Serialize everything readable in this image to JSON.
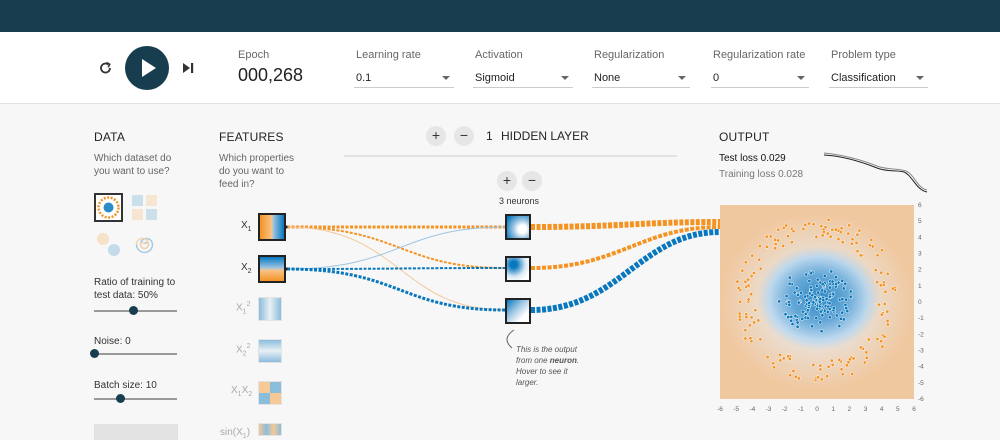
{
  "controls": {
    "epoch_label": "Epoch",
    "epoch_value": "000,268",
    "learning_rate": {
      "label": "Learning rate",
      "value": "0.1"
    },
    "activation": {
      "label": "Activation",
      "value": "Sigmoid"
    },
    "regularization": {
      "label": "Regularization",
      "value": "None"
    },
    "regularization_rate": {
      "label": "Regularization rate",
      "value": "0"
    },
    "problem_type": {
      "label": "Problem type",
      "value": "Classification"
    }
  },
  "data_panel": {
    "heading": "DATA",
    "question": [
      "Which dataset do",
      "you want to use?"
    ],
    "ratio_label": [
      "Ratio of training to",
      "test data:  50%"
    ],
    "ratio_fraction": 0.5,
    "noise_label": "Noise:  0",
    "noise_fraction": 0.0,
    "batch_label": "Batch size:  10",
    "batch_fraction": 0.33
  },
  "features_panel": {
    "heading": "FEATURES",
    "question": [
      "Which properties",
      "do you want to",
      "feed in?"
    ],
    "features": [
      {
        "base": "X",
        "sub": "1",
        "sup": ""
      },
      {
        "base": "X",
        "sub": "2",
        "sup": ""
      },
      {
        "base": "X",
        "sub": "1",
        "sup": "2"
      },
      {
        "base": "X",
        "sub": "2",
        "sup": "2"
      },
      {
        "base": "X",
        "sub": "1",
        "base2": "X",
        "sub2": "2"
      },
      {
        "base": "sin(X",
        "sub": "1",
        "tail": ")"
      }
    ]
  },
  "network": {
    "plus": "+",
    "minus": "−",
    "layers_count": "1",
    "layers_label": "HIDDEN LAYER",
    "neurons_label": "3 neurons",
    "tooltip": [
      "This is the output",
      "from one ",
      "neuron",
      ". ",
      "Hover to see it",
      "larger."
    ]
  },
  "output_panel": {
    "heading": "OUTPUT",
    "test_loss": "Test loss 0.029",
    "training_loss": "Training loss 0.028",
    "x_ticks": [
      "-6",
      "-5",
      "-4",
      "-3",
      "-2",
      "-1",
      "0",
      "1",
      "2",
      "3",
      "4",
      "5",
      "6"
    ],
    "y_ticks": [
      "6",
      "5",
      "4",
      "3",
      "2",
      "1",
      "0",
      "-1",
      "-2",
      "-3",
      "-4",
      "-5",
      "-6"
    ]
  },
  "colors": {
    "orange": "#f59322",
    "blue": "#0877bd",
    "dark": "#183d4e"
  }
}
